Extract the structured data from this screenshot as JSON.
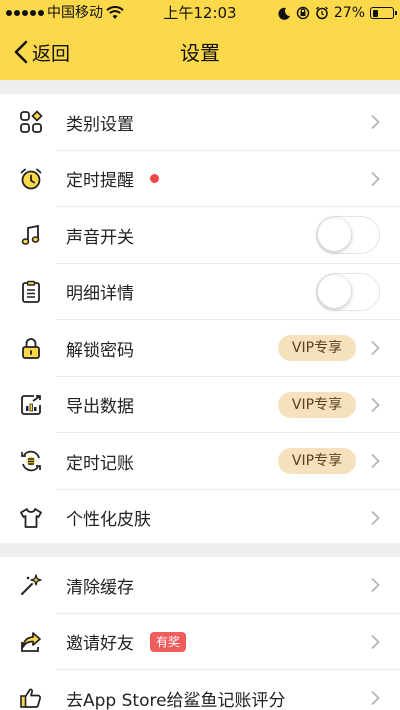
{
  "status_bar": {
    "carrier": "中国移动",
    "time": "上午12:03",
    "battery_percent": "27%",
    "battery_level": 0.27,
    "icons": [
      "signal-icon",
      "wifi-icon",
      "moon-icon",
      "orientation-lock-icon",
      "alarm-icon",
      "battery-icon"
    ]
  },
  "nav": {
    "back_label": "返回",
    "title": "设置"
  },
  "colors": {
    "header_bg": "#fbd94a",
    "page_bg": "#efefef",
    "vip_bg": "#f5e1bb",
    "vip_text": "#5b3f1f",
    "red_dot": "#f04747",
    "award_bg": "#ef5d5d"
  },
  "settings_section": [
    {
      "label": "类别设置",
      "icon": "category-grid-icon",
      "accessory": "chevron"
    },
    {
      "label": "定时提醒",
      "icon": "alarm-clock-icon",
      "accessory": "chevron",
      "red_dot": true
    },
    {
      "label": "声音开关",
      "icon": "music-note-icon",
      "accessory": "toggle",
      "toggle_on": false
    },
    {
      "label": "明细详情",
      "icon": "clipboard-list-icon",
      "accessory": "toggle",
      "toggle_on": false
    },
    {
      "label": "解锁密码",
      "icon": "lock-icon",
      "accessory": "chevron",
      "badge": "VIP专享"
    },
    {
      "label": "导出数据",
      "icon": "export-chart-icon",
      "accessory": "chevron",
      "badge": "VIP专享"
    },
    {
      "label": "定时记账",
      "icon": "recurring-bill-icon",
      "accessory": "chevron",
      "badge": "VIP专享"
    },
    {
      "label": "个性化皮肤",
      "icon": "tshirt-icon",
      "accessory": "chevron"
    }
  ],
  "other_section": [
    {
      "label": "清除缓存",
      "icon": "sparkle-clear-icon",
      "accessory": "chevron"
    },
    {
      "label": "邀请好友",
      "icon": "share-icon",
      "accessory": "chevron",
      "award_badge": "有奖"
    },
    {
      "label": "去App Store给鲨鱼记账评分",
      "icon": "thumbs-up-icon",
      "accessory": "chevron"
    }
  ]
}
